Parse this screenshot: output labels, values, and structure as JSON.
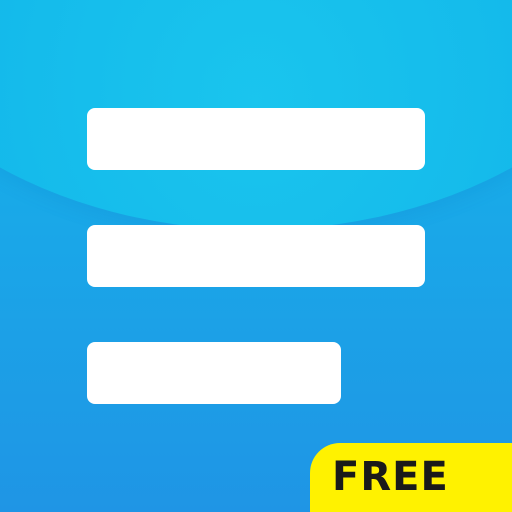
{
  "app_icon": {
    "badge": {
      "label": "FREE"
    },
    "colors": {
      "background_top": "#11b6ea",
      "background_bottom": "#1f95e5",
      "bars": "#ffffff",
      "badge_background": "#fff200",
      "badge_text": "#1a1a1a"
    },
    "icon_name": "menu-list-icon"
  }
}
